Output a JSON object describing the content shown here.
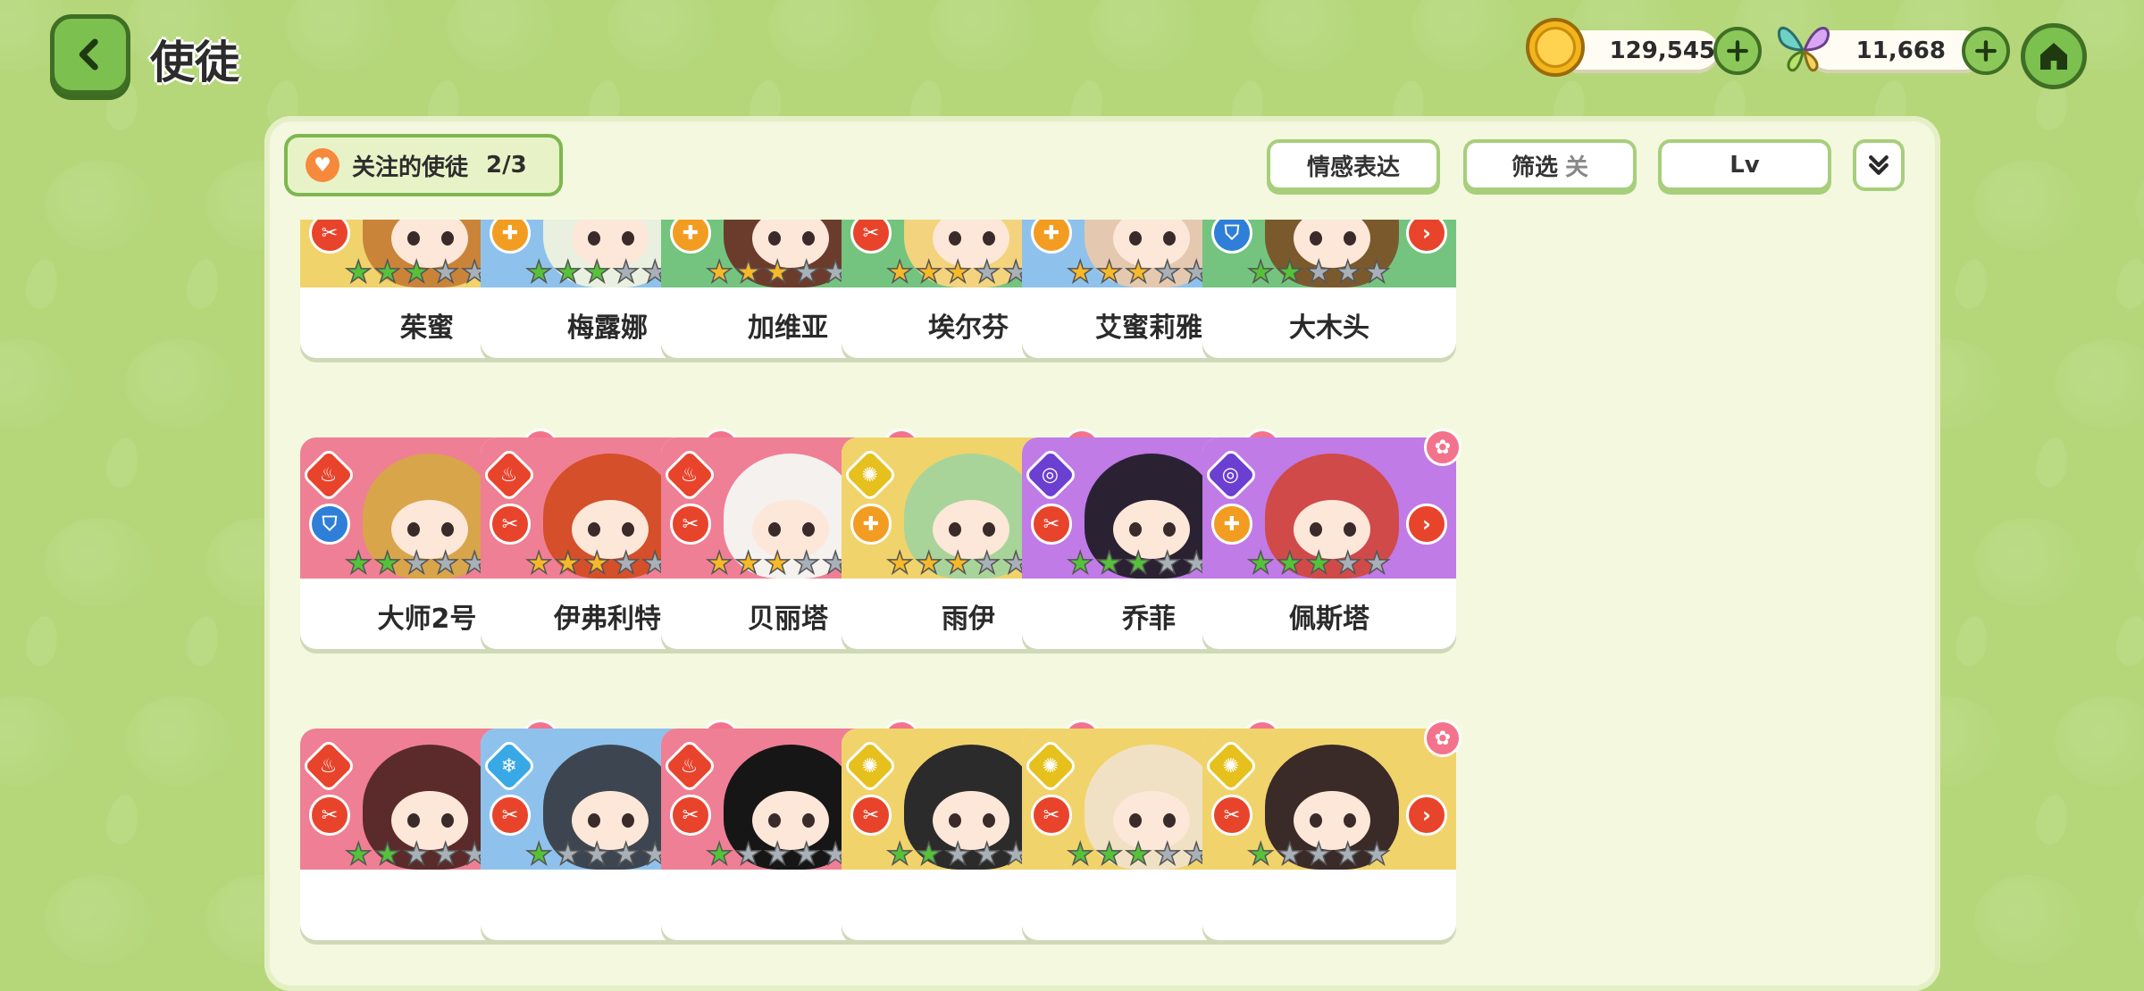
{
  "header": {
    "title": "使徒"
  },
  "currency": {
    "gold": "129,545",
    "gems": "11,668"
  },
  "toolbar": {
    "follow_label": "关注的使徒",
    "follow_count": "2/3",
    "emotion_label": "情感表达",
    "filter_label": "筛选",
    "filter_state": "关",
    "sort_label": "Lv"
  },
  "colors": {
    "yellow": "#f1d36b",
    "blue": "#8ec2ec",
    "green": "#74c47f",
    "pink": "#ef7f95",
    "purple": "#c07be7",
    "gold_star": "#f7b928",
    "green_star": "#55c23a",
    "grey_star": "#a8b0b8",
    "elem_light": "#e6c01c",
    "elem_water": "#38a8e6",
    "elem_nature": "#4bb55a",
    "elem_fire": "#e8442c",
    "elem_dark": "#6b3fd1",
    "role_attack": "#e8442c",
    "role_support": "#f39c22",
    "role_defense": "#2f7fd8",
    "grade_green": "#5cbd3b",
    "grade_blue": "#2f7fd8",
    "grade_red": "#e8442c"
  },
  "characters": [
    {
      "name": "茱蜜",
      "bg": "yellow",
      "element": "light",
      "role": "attack",
      "grade": "green",
      "stars": 3,
      "star_color": "green",
      "fav": false
    },
    {
      "name": "梅露娜",
      "bg": "blue",
      "element": "water",
      "role": "support",
      "grade": "blue",
      "stars": 3,
      "star_color": "green",
      "fav": false
    },
    {
      "name": "加维亚",
      "bg": "green",
      "element": "nature",
      "role": "support",
      "grade": "green",
      "stars": 3,
      "star_color": "gold",
      "fav": false
    },
    {
      "name": "埃尔芬",
      "bg": "green",
      "element": "nature",
      "role": "attack",
      "grade": "blue",
      "stars": 3,
      "star_color": "gold",
      "fav": false
    },
    {
      "name": "艾蜜莉雅",
      "bg": "blue",
      "element": "water",
      "role": "support",
      "grade": "blue",
      "stars": 3,
      "star_color": "gold",
      "fav": false
    },
    {
      "name": "大木头",
      "bg": "green",
      "element": "nature",
      "role": "defense",
      "grade": "red",
      "stars": 2,
      "star_color": "green",
      "fav": false
    },
    {
      "name": "大师2号",
      "bg": "pink",
      "element": "fire",
      "role": "defense",
      "grade": "red",
      "stars": 2,
      "star_color": "green",
      "fav": true
    },
    {
      "name": "伊弗利特",
      "bg": "pink",
      "element": "fire",
      "role": "attack",
      "grade": "red",
      "stars": 3,
      "star_color": "gold",
      "fav": true
    },
    {
      "name": "贝丽塔",
      "bg": "pink",
      "element": "fire",
      "role": "attack",
      "grade": "blue",
      "stars": 3,
      "star_color": "gold",
      "fav": true
    },
    {
      "name": "雨伊",
      "bg": "yellow",
      "element": "light",
      "role": "support",
      "grade": "green",
      "stars": 3,
      "star_color": "gold",
      "fav": true
    },
    {
      "name": "乔菲",
      "bg": "purple",
      "element": "dark",
      "role": "attack",
      "grade": "green",
      "stars": 3,
      "star_color": "green",
      "fav": true
    },
    {
      "name": "佩斯塔",
      "bg": "purple",
      "element": "dark",
      "role": "support",
      "grade": "red",
      "stars": 3,
      "star_color": "green",
      "fav": true
    },
    {
      "name": "",
      "bg": "pink",
      "element": "fire",
      "role": "attack",
      "grade": "blue",
      "stars": 2,
      "star_color": "green",
      "fav": true
    },
    {
      "name": "",
      "bg": "blue",
      "element": "water",
      "role": "attack",
      "grade": "red",
      "stars": 1,
      "star_color": "green",
      "fav": true
    },
    {
      "name": "",
      "bg": "pink",
      "element": "fire",
      "role": "attack",
      "grade": "blue",
      "stars": 1,
      "star_color": "green",
      "fav": true
    },
    {
      "name": "",
      "bg": "yellow",
      "element": "light",
      "role": "attack",
      "grade": "blue",
      "stars": 2,
      "star_color": "green",
      "fav": true
    },
    {
      "name": "",
      "bg": "yellow",
      "element": "light",
      "role": "attack",
      "grade": "green",
      "stars": 3,
      "star_color": "green",
      "fav": true
    },
    {
      "name": "",
      "bg": "yellow",
      "element": "light",
      "role": "attack",
      "grade": "red",
      "stars": 1,
      "star_color": "green",
      "fav": true
    }
  ]
}
